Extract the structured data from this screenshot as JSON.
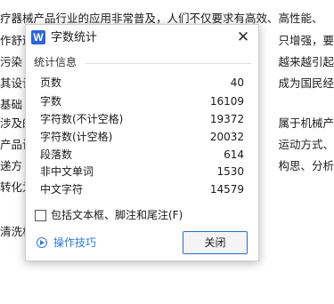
{
  "document": {
    "lines": [
      "疗器械产品行业的应用非常普及，人们不仅要求有高效、高性能、",
      "作舒适",
      "只增强，要",
      "污染",
      "越来越引起",
      "其设计",
      "成为国民经",
      "基础",
      "涉及的",
      "属于机械产",
      "产品设",
      "运动方式、",
      "递方",
      "构思、分析",
      "转化为",
      "清洗机"
    ]
  },
  "dialog": {
    "app_icon": "W",
    "title": "字数统计",
    "close_icon": "✕",
    "group_label": "统计信息",
    "stats": [
      {
        "label": "页数",
        "value": "40"
      },
      {
        "label": "字数",
        "value": "16109"
      },
      {
        "label": "字符数(不计空格)",
        "value": "19372"
      },
      {
        "label": "字符数(计空格)",
        "value": "20032"
      },
      {
        "label": "段落数",
        "value": "614"
      },
      {
        "label": "非中文单词",
        "value": "1530"
      },
      {
        "label": "中文字符",
        "value": "14579"
      }
    ],
    "checkbox_label": "包括文本框、脚注和尾注(F)",
    "checkbox_checked": false,
    "tips_label": "操作技巧",
    "close_button_label": "关闭"
  },
  "colors": {
    "accent": "#2b66d9",
    "link": "#2e7bd6",
    "button_border": "#2d6ec9"
  }
}
